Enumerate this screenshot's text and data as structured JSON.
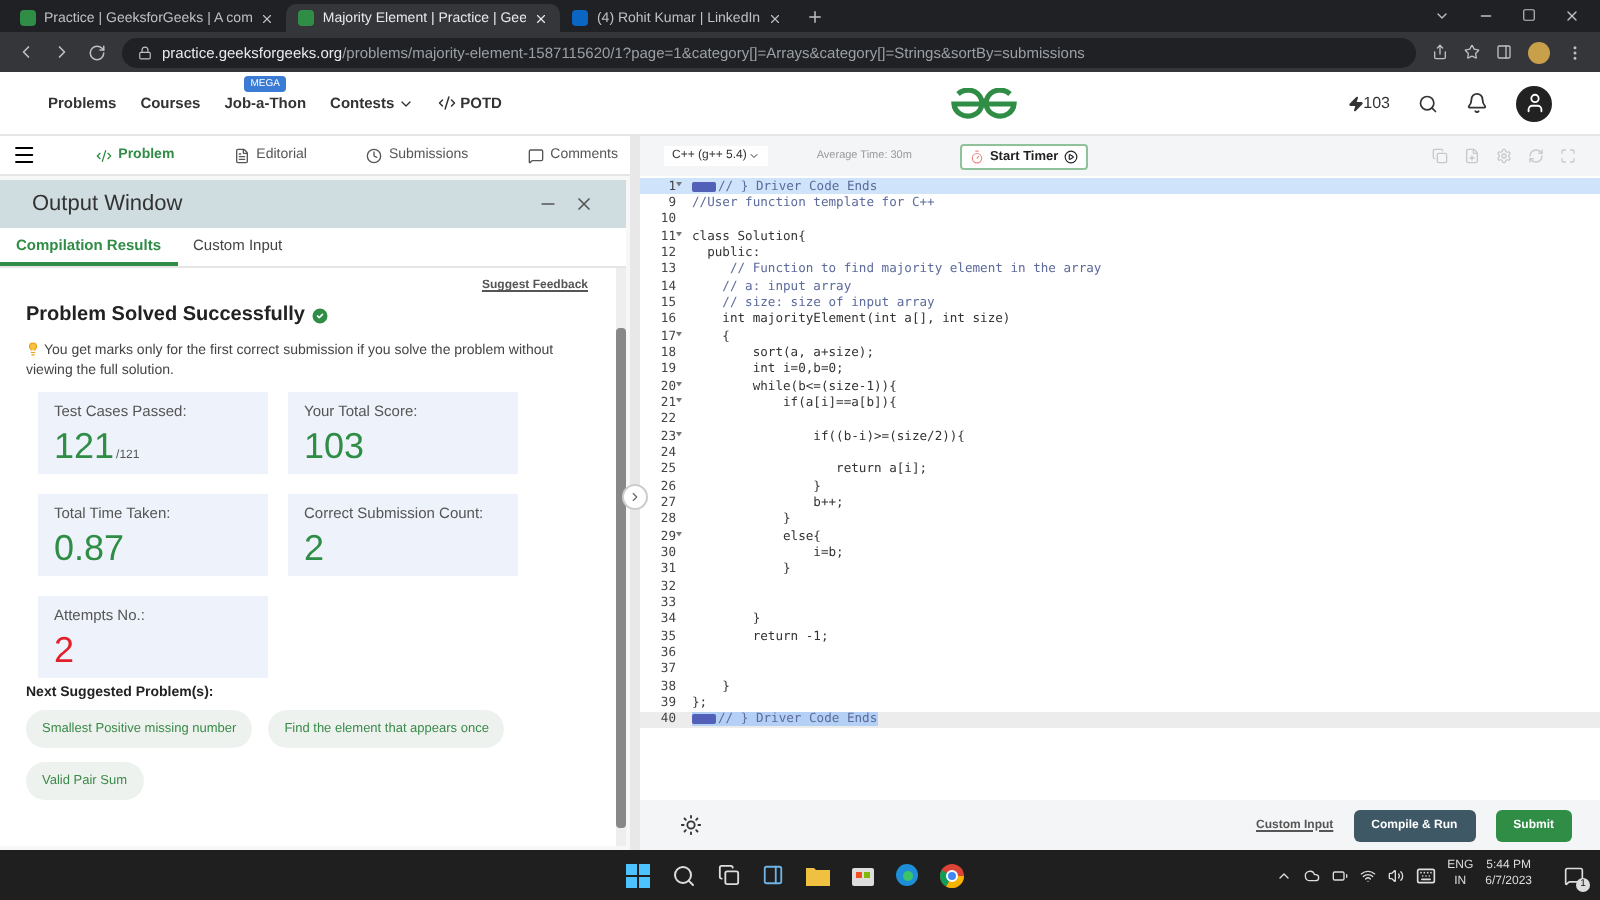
{
  "browser": {
    "tabs": [
      {
        "title": "Practice | GeeksforGeeks | A com",
        "selected": false,
        "kind": "gfg"
      },
      {
        "title": "Majority Element | Practice | Gee",
        "selected": true,
        "kind": "gfg"
      },
      {
        "title": "(4) Rohit Kumar | LinkedIn",
        "selected": false,
        "kind": "linkedin"
      }
    ],
    "address": {
      "domain": "practice.geeksforgeeks.org",
      "path": "/problems/majority-element-1587115620/1?page=1&category[]=Arrays&category[]=Strings&sortBy=submissions"
    }
  },
  "site_nav": {
    "links": [
      {
        "label": "Problems",
        "kind": "plain"
      },
      {
        "label": "Courses",
        "kind": "plain"
      },
      {
        "label": "Job-a-Thon",
        "kind": "badge",
        "badge": "MEGA"
      },
      {
        "label": "Contests",
        "kind": "dropdown"
      },
      {
        "label": "POTD",
        "kind": "code"
      }
    ],
    "streak": "103"
  },
  "problem_tabs": [
    {
      "label": "Problem",
      "selected": true,
      "kind": "code"
    },
    {
      "label": "Editorial",
      "selected": false,
      "kind": "doc"
    },
    {
      "label": "Submissions",
      "selected": false,
      "kind": "clock"
    },
    {
      "label": "Comments",
      "selected": false,
      "kind": "chat"
    }
  ],
  "output_window": {
    "title": "Output Window",
    "tabs": [
      {
        "label": "Compilation Results",
        "selected": true
      },
      {
        "label": "Custom Input",
        "selected": false
      }
    ],
    "feedback_link": "Suggest Feedback",
    "status": "Problem Solved Successfully",
    "note": "You get marks only for the first correct submission if you solve the problem without viewing the full solution.",
    "stats": [
      {
        "label": "Test Cases Passed:",
        "value": "121",
        "suffix": "/121",
        "color": "#2f8d46"
      },
      {
        "label": "Your Total Score:",
        "value": "103",
        "color": "#2f8d46"
      },
      {
        "label": "Total Time Taken:",
        "value": "0.87",
        "color": "#2f8d46"
      },
      {
        "label": "Correct Submission Count:",
        "value": "2",
        "color": "#2f8d46"
      },
      {
        "label": "Attempts No.:",
        "value": "2",
        "color": "#e0212b"
      }
    ],
    "suggested_heading": "Next Suggested Problem(s):",
    "suggestions": [
      "Smallest Positive missing number",
      "Find the element that appears once",
      "Valid Pair Sum"
    ]
  },
  "editor": {
    "language": "C++ (g++ 5.4)",
    "average_time": "Average Time: 30m",
    "timer_button": "Start Timer",
    "lines": [
      {
        "number": "1",
        "kind": "marker",
        "text": "// } Driver Code Ends",
        "foldable": true,
        "active": true,
        "text_selected": false
      },
      {
        "number": "9",
        "kind": "comment",
        "text": "//User function template for C++",
        "foldable": false,
        "active": false,
        "text_selected": false
      },
      {
        "number": "10",
        "foldable": false,
        "active": false,
        "text_selected": false
      },
      {
        "number": "11",
        "kind": "code",
        "text": "class Solution{",
        "foldable": true,
        "active": false,
        "text_selected": false
      },
      {
        "number": "12",
        "kind": "code",
        "text": "  public:",
        "foldable": false,
        "active": false,
        "text_selected": false
      },
      {
        "number": "13",
        "kind": "comment",
        "text": "     // Function to find majority element in the array",
        "foldable": false,
        "active": false,
        "text_selected": false
      },
      {
        "number": "14",
        "kind": "comment",
        "text": "    // a: input array",
        "foldable": false,
        "active": false,
        "text_selected": false
      },
      {
        "number": "15",
        "kind": "comment",
        "text": "    // size: size of input array",
        "foldable": false,
        "active": false,
        "text_selected": false
      },
      {
        "number": "16",
        "kind": "code",
        "text": "    int majorityElement(int a[], int size)",
        "foldable": false,
        "active": false,
        "text_selected": false
      },
      {
        "number": "17",
        "kind": "code",
        "text": "    {",
        "foldable": true,
        "active": false,
        "text_selected": false
      },
      {
        "number": "18",
        "kind": "code",
        "text": "        sort(a, a+size);",
        "foldable": false,
        "active": false,
        "text_selected": false
      },
      {
        "number": "19",
        "kind": "code",
        "text": "        int i=0,b=0;",
        "foldable": false,
        "active": false,
        "text_selected": false
      },
      {
        "number": "20",
        "kind": "code",
        "text": "        while(b<=(size-1)){",
        "foldable": true,
        "active": false,
        "text_selected": false
      },
      {
        "number": "21",
        "kind": "code",
        "text": "            if(a[i]==a[b]){",
        "foldable": true,
        "active": false,
        "text_selected": false
      },
      {
        "number": "22",
        "foldable": false,
        "active": false,
        "text_selected": false
      },
      {
        "number": "23",
        "kind": "code",
        "text": "                if((b-i)>=(size/2)){",
        "foldable": true,
        "active": false,
        "text_selected": false
      },
      {
        "number": "24",
        "foldable": false,
        "active": false,
        "text_selected": false
      },
      {
        "number": "25",
        "kind": "code",
        "text": "                   return a[i];",
        "foldable": false,
        "active": false,
        "text_selected": false
      },
      {
        "number": "26",
        "kind": "code",
        "text": "                }",
        "foldable": false,
        "active": false,
        "text_selected": false
      },
      {
        "number": "27",
        "kind": "code",
        "text": "                b++;",
        "foldable": false,
        "active": false,
        "text_selected": false
      },
      {
        "number": "28",
        "kind": "code",
        "text": "            }",
        "foldable": false,
        "active": false,
        "text_selected": false
      },
      {
        "number": "29",
        "kind": "code",
        "text": "            else{",
        "foldable": true,
        "active": false,
        "text_selected": false
      },
      {
        "number": "30",
        "kind": "code",
        "text": "                i=b;",
        "foldable": false,
        "active": false,
        "text_selected": false
      },
      {
        "number": "31",
        "kind": "code",
        "text": "            }",
        "foldable": false,
        "active": false,
        "text_selected": false
      },
      {
        "number": "32",
        "foldable": false,
        "active": false,
        "text_selected": false
      },
      {
        "number": "33",
        "foldable": false,
        "active": false,
        "text_selected": false
      },
      {
        "number": "34",
        "kind": "code",
        "text": "        }",
        "foldable": false,
        "active": false,
        "text_selected": false
      },
      {
        "number": "35",
        "kind": "code",
        "text": "        return -1;",
        "foldable": false,
        "active": false,
        "text_selected": false
      },
      {
        "number": "36",
        "foldable": false,
        "active": false,
        "text_selected": false
      },
      {
        "number": "37",
        "foldable": false,
        "active": false,
        "text_selected": false
      },
      {
        "number": "38",
        "kind": "code",
        "text": "    }",
        "foldable": false,
        "active": false,
        "text_selected": false
      },
      {
        "number": "39",
        "kind": "code",
        "text": "};",
        "foldable": false,
        "active": false,
        "text_selected": false
      },
      {
        "number": "40",
        "kind": "marker",
        "text": "// } Driver Code Ends",
        "foldable": false,
        "active": false,
        "text_selected": true
      }
    ],
    "custom_input_link": "Custom Input",
    "compile_button": "Compile & Run",
    "submit_button": "Submit"
  },
  "taskbar": {
    "language": "ENG",
    "region": "IN",
    "time": "5:44 PM",
    "date": "6/7/2023",
    "notifications": "1"
  }
}
